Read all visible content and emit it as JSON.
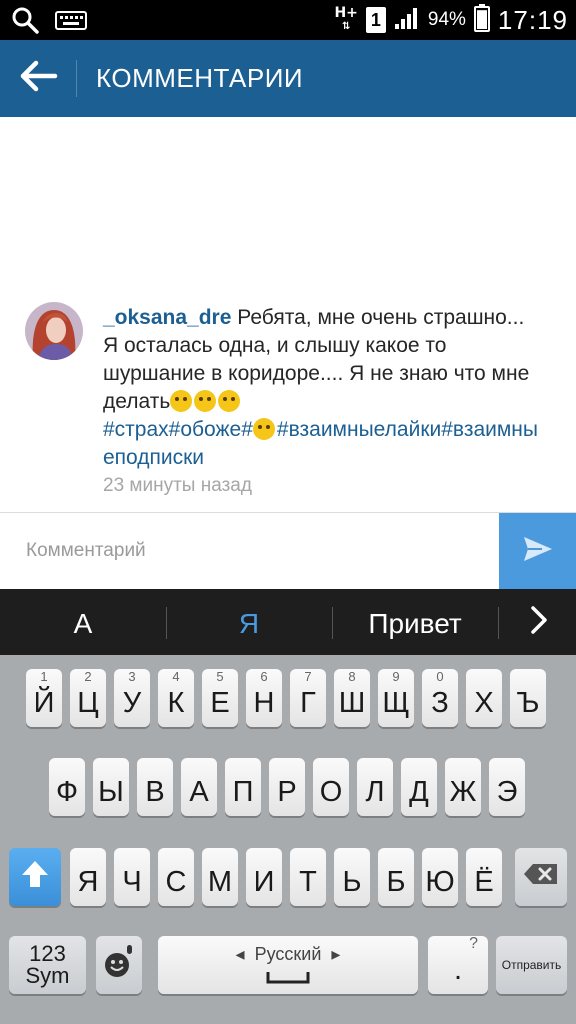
{
  "status_bar": {
    "network_type": "H+",
    "sim_slot": "1",
    "battery_percent": "94%",
    "time": "17:19",
    "battery_level": 0.94
  },
  "app_bar": {
    "title": "КОММЕНТАРИИ"
  },
  "comment": {
    "username": "_oksana_dre",
    "text_part1": " Ребята, мне очень страшно... Я осталась одна, и слышу какое то шуршание в коридоре.... Я не знаю что мне делать",
    "hashtags_part1": "#страх#обоже#",
    "hashtags_part2": "#взаимныелайки#взаимныеподписки",
    "timestamp": "23 минуты назад"
  },
  "comment_input": {
    "placeholder": "Комментарий",
    "value": ""
  },
  "suggestions": [
    "А",
    "Я",
    "Привет"
  ],
  "suggestion_highlight_color": "#4c9ade",
  "keyboard": {
    "row1": [
      {
        "label": "Й",
        "hint": "1"
      },
      {
        "label": "Ц",
        "hint": "2"
      },
      {
        "label": "У",
        "hint": "3"
      },
      {
        "label": "К",
        "hint": "4"
      },
      {
        "label": "Е",
        "hint": "5"
      },
      {
        "label": "Н",
        "hint": "6"
      },
      {
        "label": "Г",
        "hint": "7"
      },
      {
        "label": "Ш",
        "hint": "8"
      },
      {
        "label": "Щ",
        "hint": "9"
      },
      {
        "label": "З",
        "hint": "0"
      },
      {
        "label": "Х",
        "hint": ""
      },
      {
        "label": "Ъ",
        "hint": ""
      }
    ],
    "row2": [
      "Ф",
      "Ы",
      "В",
      "А",
      "П",
      "Р",
      "О",
      "Л",
      "Д",
      "Ж",
      "Э"
    ],
    "row3": [
      "Я",
      "Ч",
      "С",
      "М",
      "И",
      "Т",
      "Ь",
      "Б",
      "Ю",
      "Ё"
    ],
    "sym_line1": "123",
    "sym_line2": "Sym",
    "space_label": "Русский",
    "period_label": ".",
    "period_hint": "?",
    "send_label": "Отправить"
  },
  "icons": {
    "search": "search-icon",
    "keyboard_status": "keyboard-icon",
    "back": "arrow-left-icon",
    "send": "send-icon",
    "next": "chevron-right-icon",
    "shift": "shift-arrow-icon",
    "backspace": "backspace-icon",
    "emoji": "smiley-icon",
    "mic": "microphone-icon"
  },
  "colors": {
    "app_bar": "#1c5f93",
    "link": "#1c5f93",
    "send_button": "#4c9ade"
  }
}
